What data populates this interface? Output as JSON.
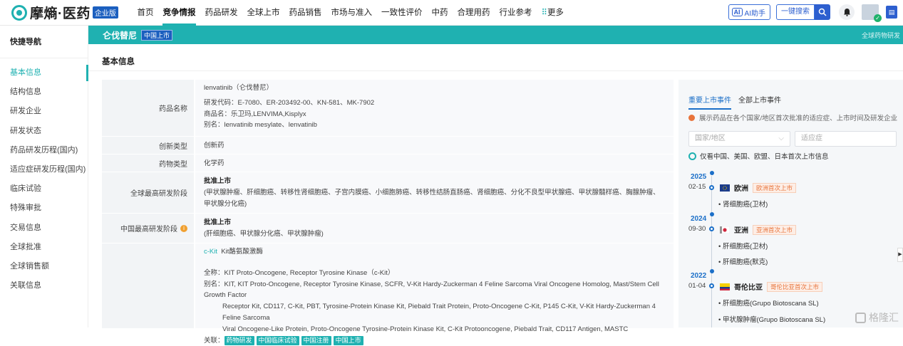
{
  "brand": {
    "name": "摩熵·医药",
    "edition": "企业版"
  },
  "nav": {
    "items": [
      "首页",
      "竞争情报",
      "药品研发",
      "全球上市",
      "药品销售",
      "市场与准入",
      "一致性评价",
      "中药",
      "合理用药",
      "行业参考"
    ],
    "active_index": 1,
    "more": "更多"
  },
  "topbar": {
    "ai_label": "AI助手",
    "ai_badge": "AI",
    "search_label": "一键搜索"
  },
  "sidebar": {
    "title": "快捷导航",
    "items": [
      "基本信息",
      "结构信息",
      "研发企业",
      "研发状态",
      "药品研发历程(国内)",
      "适应症研发历程(国内)",
      "临床试验",
      "特殊审批",
      "交易信息",
      "全球批准",
      "全球销售额",
      "关联信息"
    ],
    "active_index": 0
  },
  "header": {
    "drug_name": "仑伐替尼",
    "badge": "中国上市",
    "right_text": "全球药物研发"
  },
  "section": {
    "title": "基本信息"
  },
  "info": {
    "drug_name_label": "药品名称",
    "drug_name_lines": [
      "lenvatinib（仑伐替尼）",
      "研发代码：E-7080、ER-203492-00、KN-581、MK-7902",
      "商品名：乐卫玛,LENVIMA,Kisplyx",
      "别名：lenvatinib mesylate、lenvatinib"
    ],
    "innovation_label": "创新类型",
    "innovation_value": "创新药",
    "type_label": "药物类型",
    "type_value": "化学药",
    "global_stage_label": "全球最高研发阶段",
    "global_stage_value": "批准上市",
    "global_stage_detail": "(甲状腺肿瘤、肝细胞癌、转移性肾细胞癌、子宫内膜癌、小细胞肺癌、转移性结肠直肠癌、肾细胞癌、分化不良型甲状腺癌、甲状腺髓样癌、胸腺肿瘤、甲状腺分化癌)",
    "china_stage_label": "中国最高研发阶段",
    "china_stage_value": "批准上市",
    "china_stage_detail": "(肝细胞癌、甲状腺分化癌、甲状腺肿瘤)",
    "target_name": "c-Kit",
    "target_desc": "Kit酪氨酸激酶",
    "fullname": "全称：KIT Proto-Oncogene, Receptor Tyrosine Kinase（c-Kit）",
    "alias_lines": [
      "别名：KIT, KIT Proto-Oncogene, Receptor Tyrosine Kinase, SCFR, V-Kit Hardy-Zuckerman 4 Feline Sarcoma Viral Oncogene Homolog, Mast/Stem Cell Growth Factor",
      "Receptor Kit, CD117, C-Kit, PBT, Tyrosine-Protein Kinase Kit, Piebald Trait Protein, Proto-Oncogene C-Kit, P145 C-Kit, V-Kit Hardy-Zuckerman 4 Feline Sarcoma",
      "Viral Oncogene-Like Protein, Proto-Oncogene Tyrosine-Protein Kinase Kit, C-Kit Protooncogene, Piebald Trait, CD117 Antigen, MASTC"
    ],
    "related_label": "关联：",
    "related_tags": [
      "药物研发",
      "中国临床试验",
      "中国注册",
      "中国上市"
    ]
  },
  "panel": {
    "tabs": [
      "重要上市事件",
      "全部上市事件"
    ],
    "note": "展示药品在各个国家/地区首次批准的适应症、上市时间及研发企业",
    "country_placeholder": "国家/地区",
    "indication_placeholder": "适应症",
    "radio_label": "仅看中国、美国、欧盟、日本首次上市信息",
    "events": [
      {
        "year": "2025",
        "date": "02-15",
        "region": "欧洲",
        "badge": "欧洲首次上市",
        "indications": [
          "肾细胞癌(卫材)"
        ]
      },
      {
        "year": "2024",
        "date": "09-30",
        "region": "亚洲",
        "badge": "亚洲首次上市",
        "indications": [
          "肝细胞癌(卫材)",
          "肝细胞癌(默克)"
        ]
      },
      {
        "year": "2022",
        "date": "01-04",
        "region": "哥伦比亚",
        "badge": "哥伦比亚首次上市",
        "indications": [
          "肝细胞癌(Grupo Biotoscana SL)",
          "甲状腺肿瘤(Grupo Biotoscana SL)"
        ]
      }
    ]
  },
  "watermark": "格隆汇",
  "colors": {
    "accent": "#1fb1b1",
    "blue": "#1b6fc8",
    "orange": "#e8743b"
  }
}
